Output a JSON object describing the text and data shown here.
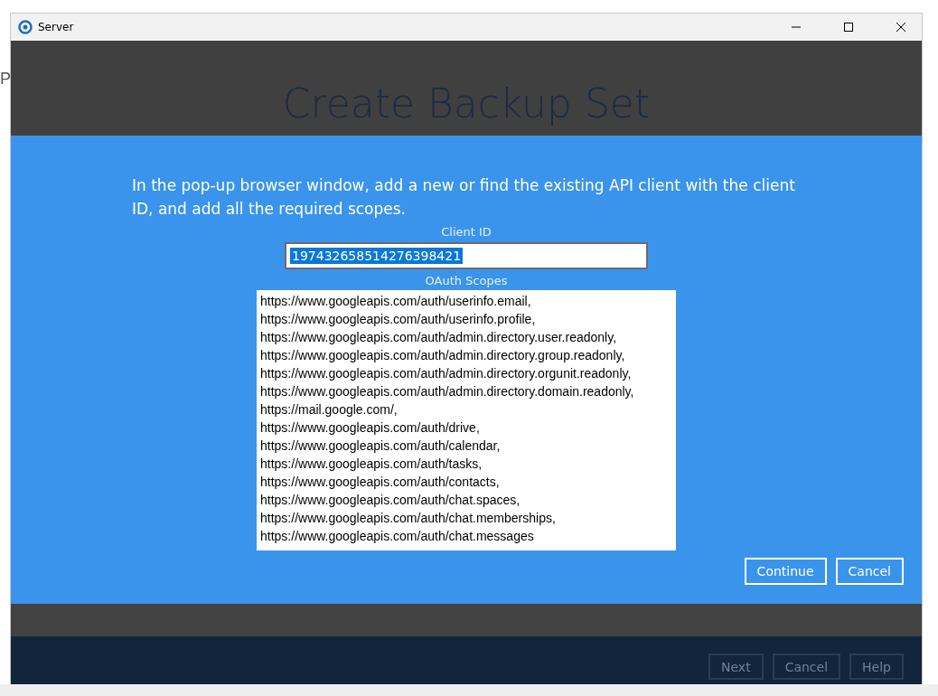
{
  "background_fragments": [
    "P"
  ],
  "window": {
    "title": "Server"
  },
  "header": {
    "title": "Create Backup Set"
  },
  "dialog": {
    "instruction": "In the pop-up browser window, add a new or find the existing API client with the client ID, and add all the required scopes.",
    "client_id": {
      "label": "Client ID",
      "value": "197432658514276398421",
      "selected": true
    },
    "scopes": {
      "label": "OAuth Scopes",
      "lines": [
        "https://www.googleapis.com/auth/userinfo.email,",
        "https://www.googleapis.com/auth/userinfo.profile,",
        "https://www.googleapis.com/auth/admin.directory.user.readonly,",
        "https://www.googleapis.com/auth/admin.directory.group.readonly,",
        "https://www.googleapis.com/auth/admin.directory.orgunit.readonly,",
        "https://www.googleapis.com/auth/admin.directory.domain.readonly,",
        "https://mail.google.com/,",
        "https://www.googleapis.com/auth/drive,",
        "https://www.googleapis.com/auth/calendar,",
        "https://www.googleapis.com/auth/tasks,",
        "https://www.googleapis.com/auth/contacts,",
        "https://www.googleapis.com/auth/chat.spaces,",
        "https://www.googleapis.com/auth/chat.memberships,",
        "https://www.googleapis.com/auth/chat.messages"
      ]
    },
    "buttons": [
      "Continue",
      "Cancel"
    ]
  },
  "footer_buttons": [
    "Next",
    "Cancel",
    "Help"
  ]
}
